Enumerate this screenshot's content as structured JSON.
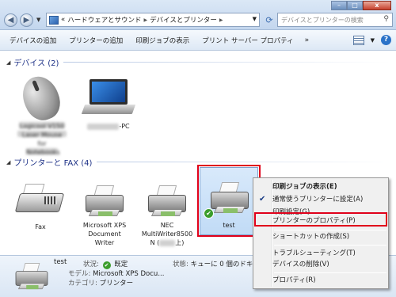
{
  "window": {
    "breadcrumb": [
      "«",
      "ハードウェアとサウンド",
      "デバイスとプリンター"
    ],
    "search_placeholder": "デバイスとプリンターの検索",
    "buttons": {
      "minimize": "–",
      "maximize": "□",
      "close": "x"
    }
  },
  "toolbar": {
    "items": [
      "デバイスの追加",
      "プリンターの追加",
      "印刷ジョブの表示",
      "プリント サーバー プロパティ"
    ],
    "more": "»"
  },
  "devices_group": {
    "header": "デバイス (2)",
    "items": [
      {
        "label_line1": "Logicool V150",
        "label_line2": "Laser Mouse for",
        "label_line3": "Notebooks",
        "icon": "mouse-icon"
      },
      {
        "label_suffix": "-PC",
        "icon": "laptop-icon"
      }
    ]
  },
  "printers_group": {
    "header": "プリンターと FAX (4)",
    "items": [
      {
        "lines": [
          "Fax"
        ],
        "icon": "fax-icon"
      },
      {
        "lines": [
          "Microsoft XPS",
          "Document",
          "Writer"
        ],
        "icon": "printer-icon"
      },
      {
        "lines": [
          "NEC",
          "MultiWriter8500",
          "N (",
          "上)"
        ],
        "icon": "printer-icon"
      },
      {
        "lines": [
          "test"
        ],
        "icon": "printer-icon",
        "default": true
      }
    ]
  },
  "details": {
    "name": "test",
    "state_label": "状況:",
    "state_value": "既定",
    "status_label": "状態:",
    "status_value": "キューに 0 個のドキュ",
    "model_label": "モデル:",
    "model_value": "Microsoft XPS Docu...",
    "category_label": "カテゴリ:",
    "category_value": "プリンター"
  },
  "context_menu": {
    "items": [
      "印刷ジョブの表示(E)",
      "通常使うプリンターに設定(A)",
      "印刷設定(G)",
      "プリンターのプロパティ(P)",
      "ショートカットの作成(S)",
      "トラブルシューティング(T)",
      "デバイスの削除(V)",
      "プロパティ(R)"
    ],
    "checked_index": 1,
    "highlighted_index": 3
  },
  "colors": {
    "highlight_box": "#e0001a",
    "group_header": "#1e3287",
    "selection": "#c1dbf6"
  }
}
